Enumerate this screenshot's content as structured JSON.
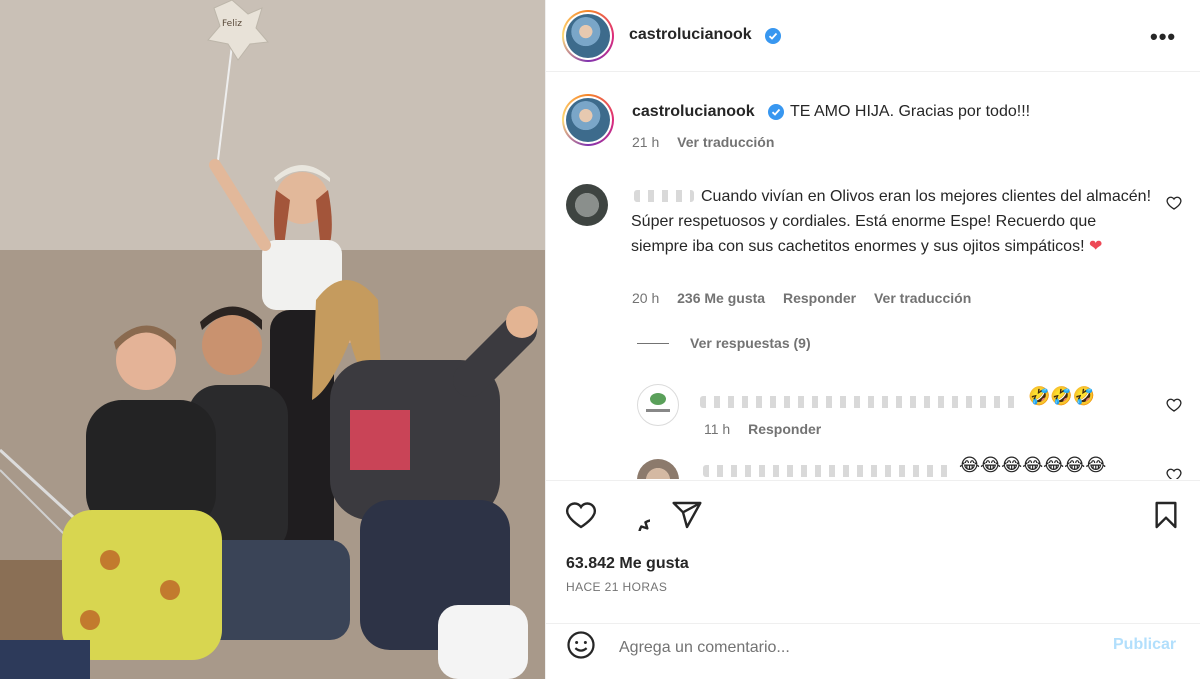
{
  "post": {
    "username": "castrolucianook",
    "caption": "TE AMO HIJA. Gracias por todo!!!",
    "caption_time": "21 h",
    "see_translation": "Ver traducción",
    "balloon_text": "Feliz"
  },
  "comments": [
    {
      "text": "Cuando vivían en Olivos eran los mejores clientes del almacén! Súper respetuosos y cordiales. Está enorme Espe! Recuerdo que siempre iba con sus cachetitos enormes y sus ojitos simpáticos!",
      "emoji": "❤",
      "time": "20 h",
      "likes": "236 Me gusta",
      "reply": "Responder",
      "see_translation": "Ver traducción",
      "view_replies": "Ver respuestas (9)"
    }
  ],
  "replies": [
    {
      "emoji": "🤣🤣🤣",
      "time": "11 h",
      "reply": "Responder"
    },
    {
      "emoji": "😂😂😂😂😂😂😂"
    }
  ],
  "footer": {
    "likes": "63.842 Me gusta",
    "ago": "HACE 21 HORAS",
    "placeholder": "Agrega un comentario...",
    "publish": "Publicar"
  },
  "icons": [
    "verified-icon",
    "more-options-icon",
    "like-icon",
    "comment-icon",
    "share-icon",
    "save-icon",
    "emoji-icon"
  ]
}
